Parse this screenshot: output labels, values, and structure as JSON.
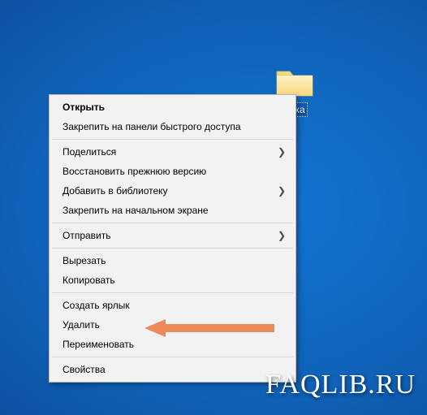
{
  "desktop": {
    "folder_label": "апка"
  },
  "context_menu": {
    "open": "Открыть",
    "pin_quick": "Закрепить на панели быстрого доступа",
    "share": "Поделиться",
    "restore": "Восстановить прежнюю версию",
    "add_library": "Добавить в библиотеку",
    "pin_start": "Закрепить на начальном экране",
    "send_to": "Отправить",
    "cut": "Вырезать",
    "copy": "Копировать",
    "shortcut": "Создать ярлык",
    "delete": "Удалить",
    "rename": "Переименовать",
    "properties": "Свойства"
  },
  "annotation": {
    "arrow_color": "#ed8a5a"
  },
  "watermark": {
    "text": "FAQLIB.RU"
  }
}
